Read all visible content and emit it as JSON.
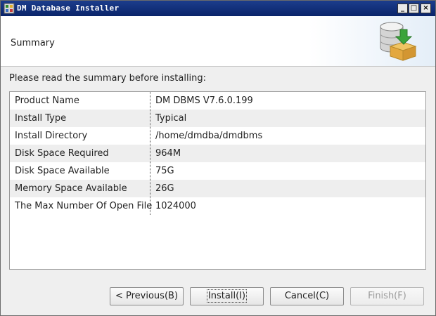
{
  "window": {
    "title": "DM Database Installer",
    "controls": {
      "minimize": "_",
      "maximize": "□",
      "close": "×"
    }
  },
  "header": {
    "title": "Summary",
    "icon": "database-install-icon"
  },
  "subtitle": "Please read the summary before installing:",
  "summary": [
    {
      "key": "Product Name",
      "value": "DM DBMS V7.6.0.199"
    },
    {
      "key": "Install Type",
      "value": "Typical"
    },
    {
      "key": "Install Directory",
      "value": "/home/dmdba/dmdbms"
    },
    {
      "key": "Disk Space Required",
      "value": "964M"
    },
    {
      "key": "Disk Space Available",
      "value": "75G"
    },
    {
      "key": "Memory Space Available",
      "value": "26G"
    },
    {
      "key": "The Max Number Of Open File",
      "value": "1024000"
    }
  ],
  "buttons": {
    "previous": "< Previous(B)",
    "install": "Install(I)",
    "cancel": "Cancel(C)",
    "finish": "Finish(F)"
  },
  "colors": {
    "titlebar": "#0a246a",
    "row_alt": "#eeeeee",
    "accent_green": "#3aa33a"
  }
}
